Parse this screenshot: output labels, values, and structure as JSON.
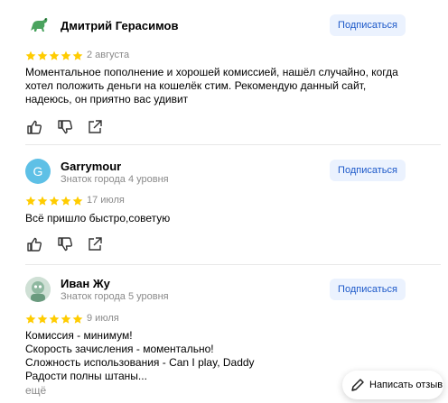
{
  "reviews": [
    {
      "author": "Дмитрий Герасимов",
      "level": "",
      "avatar": "dinosaur-avatar",
      "subscribe_label": "Подписаться",
      "rating": 5,
      "date": "2 августа",
      "text_lines": [
        "Моментальное пополнение и хорошей комиссией, нашёл случайно, когда",
        "хотел положить деньги на кошелёк стим. Рекомендую данный сайт,",
        "надеюсь, он приятно вас удивит"
      ]
    },
    {
      "author": "Garrymour",
      "level": "Знаток города 4 уровня",
      "avatar_letter": "G",
      "subscribe_label": "Подписаться",
      "rating": 5,
      "date": "17 июля",
      "text_lines": [
        "Всё пришло быстро,советую"
      ]
    },
    {
      "author": "Иван Жу",
      "level": "Знаток города 5 уровня",
      "avatar": "photo-avatar",
      "subscribe_label": "Подписаться",
      "rating": 5,
      "date": "9 июля",
      "text_lines": [
        "Комиссия - минимум!",
        "Скорость зачисления - моментально!",
        "Сложность использования - Can I play, Daddy",
        "Радости полны штаны..."
      ],
      "more_label": "ещё"
    }
  ],
  "actions": [
    "like-icon",
    "dislike-icon",
    "share-icon"
  ],
  "write_review_label": "Написать отзыв",
  "colors": {
    "star": "#fc0",
    "subscribe_bg": "#ebf2fe",
    "subscribe_text": "#1d59c9",
    "secondary_text": "#8a8a8a",
    "avatar_letter_bg": "#5ec0e6"
  }
}
